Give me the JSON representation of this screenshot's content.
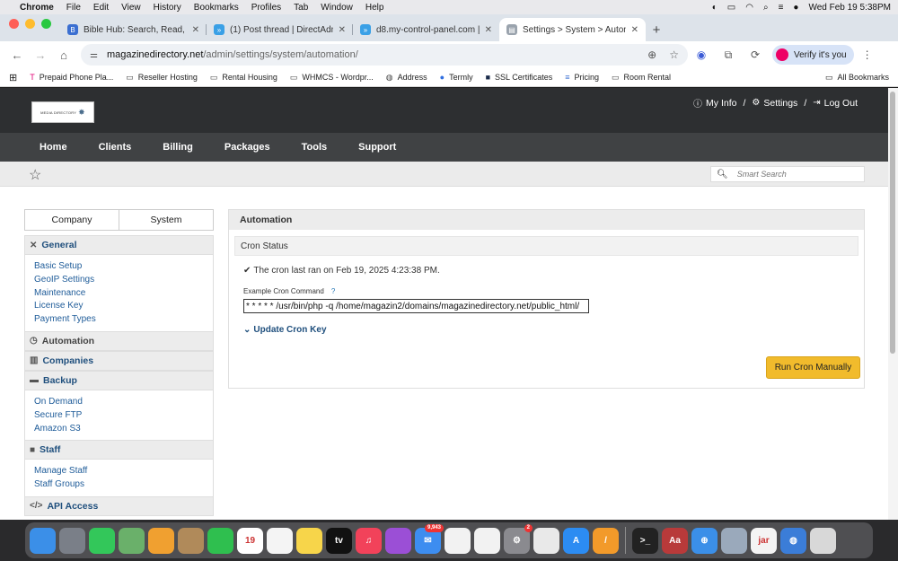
{
  "menubar": {
    "app": "Chrome",
    "items": [
      "File",
      "Edit",
      "View",
      "History",
      "Bookmarks",
      "Profiles",
      "Tab",
      "Window",
      "Help"
    ],
    "datetime": "Wed Feb 19  5:38PM"
  },
  "tabs": [
    {
      "title": "Bible Hub: Search, Read, Stu",
      "color": "#3b6fd1",
      "glyph": "B"
    },
    {
      "title": "(1) Post thread | DirectAdmin",
      "color": "#3aa0e6",
      "glyph": "»"
    },
    {
      "title": "d8.my-control-panel.com | C",
      "color": "#3aa0e6",
      "glyph": "»"
    },
    {
      "title": "Settings > System > Automati",
      "color": "#9aa3ad",
      "glyph": "▤"
    }
  ],
  "address": {
    "host": "magazinedirectory.net",
    "path": "/admin/settings/system/automation/",
    "verify_label": "Verify it's you"
  },
  "bookmarks": [
    {
      "label": "Prepaid Phone Pla...",
      "icon": "tmobile-icon",
      "glyph": "T",
      "color": "#e20074"
    },
    {
      "label": "Reseller Hosting",
      "icon": "folder-icon",
      "glyph": "▭",
      "color": "#444"
    },
    {
      "label": "Rental Housing",
      "icon": "folder-icon",
      "glyph": "▭",
      "color": "#444"
    },
    {
      "label": "WHMCS - Wordpr...",
      "icon": "folder-icon",
      "glyph": "▭",
      "color": "#444"
    },
    {
      "label": "Address",
      "icon": "globe-icon",
      "glyph": "◍",
      "color": "#444"
    },
    {
      "label": "Termly",
      "icon": "termly-icon",
      "glyph": "●",
      "color": "#2f6ee0"
    },
    {
      "label": "SSL Certificates",
      "icon": "ssl-icon",
      "glyph": "■",
      "color": "#1a2b4a"
    },
    {
      "label": "Pricing",
      "icon": "pricing-icon",
      "glyph": "≡",
      "color": "#3b6fd1"
    },
    {
      "label": "Room Rental",
      "icon": "folder-icon",
      "glyph": "▭",
      "color": "#444"
    }
  ],
  "all_bookmarks": "All Bookmarks",
  "site": {
    "logo_text": "MEDIA DIRECTORY",
    "toplinks": {
      "my_info": "My Info",
      "settings": "Settings",
      "logout": "Log Out",
      "sep": "/"
    },
    "nav": [
      "Home",
      "Clients",
      "Billing",
      "Packages",
      "Tools",
      "Support"
    ],
    "search_placeholder": "Smart Search"
  },
  "sidebar": {
    "tabs": [
      "Company",
      "System"
    ],
    "sections": [
      {
        "title": "General",
        "icon": "tools-icon",
        "glyph": "✕",
        "links": [
          "Basic Setup",
          "GeoIP Settings",
          "Maintenance",
          "License Key",
          "Payment Types"
        ]
      },
      {
        "title": "Automation",
        "icon": "clock-icon",
        "glyph": "◷",
        "links": []
      },
      {
        "title": "Companies",
        "icon": "building-icon",
        "glyph": "▥",
        "links": []
      },
      {
        "title": "Backup",
        "icon": "drive-icon",
        "glyph": "▬",
        "links": [
          "On Demand",
          "Secure FTP",
          "Amazon S3"
        ]
      },
      {
        "title": "Staff",
        "icon": "user-icon",
        "glyph": "■",
        "links": [
          "Manage Staff",
          "Staff Groups"
        ]
      },
      {
        "title": "API Access",
        "icon": "code-icon",
        "glyph": "</>",
        "links": []
      }
    ]
  },
  "panel": {
    "title": "Automation",
    "cron_status": "Cron Status",
    "last_ran": "The cron last ran on Feb 19, 2025 4:23:38 PM.",
    "cmd_label": "Example Cron Command",
    "cmd_help": "?",
    "cmd_value": "* * * * * /usr/bin/php -q /home/magazin2/domains/magazinedirectory.net/public_html/",
    "update_key": "Update Cron Key",
    "run_button": "Run Cron Manually"
  },
  "dock": {
    "apps": [
      {
        "name": "finder-icon",
        "color": "#3b8fe8",
        "label": ""
      },
      {
        "name": "launchpad-icon",
        "color": "#7a7f88",
        "label": ""
      },
      {
        "name": "messages-icon",
        "color": "#33c75a",
        "label": ""
      },
      {
        "name": "maps-icon",
        "color": "#6ab06a",
        "label": ""
      },
      {
        "name": "photos-icon",
        "color": "#f0a030",
        "label": ""
      },
      {
        "name": "contacts-icon",
        "color": "#b08a5a",
        "label": ""
      },
      {
        "name": "facetime-icon",
        "color": "#2fbf4f",
        "label": ""
      },
      {
        "name": "calendar-icon",
        "color": "#ffffff",
        "label": "19"
      },
      {
        "name": "reminders-icon",
        "color": "#f4f4f4",
        "label": ""
      },
      {
        "name": "notes-icon",
        "color": "#f7d54a",
        "label": ""
      },
      {
        "name": "tv-icon",
        "color": "#111111",
        "label": "tv"
      },
      {
        "name": "music-icon",
        "color": "#f2425a",
        "label": "♫"
      },
      {
        "name": "podcasts-icon",
        "color": "#9b4fd6",
        "label": ""
      },
      {
        "name": "mail-icon",
        "color": "#3d8df0",
        "label": "✉",
        "badge": "9,943"
      },
      {
        "name": "freeform-icon",
        "color": "#f2f2f2",
        "label": ""
      },
      {
        "name": "news-icon",
        "color": "#f2f2f2",
        "label": ""
      },
      {
        "name": "settings-icon",
        "color": "#8a8a8f",
        "label": "⚙",
        "badge": "2"
      },
      {
        "name": "chrome-icon",
        "color": "#e9e9e9",
        "label": ""
      },
      {
        "name": "appstore-icon",
        "color": "#2c8cf2",
        "label": "A"
      },
      {
        "name": "pages-icon",
        "color": "#f29a2a",
        "label": "/"
      }
    ],
    "apps2": [
      {
        "name": "terminal-icon",
        "color": "#222222",
        "label": ">_"
      },
      {
        "name": "dictionary-icon",
        "color": "#b83a3a",
        "label": "Aa"
      },
      {
        "name": "safari-icon",
        "color": "#3b8fe8",
        "label": "⊕"
      },
      {
        "name": "preview-icon",
        "color": "#9aa9bb",
        "label": ""
      },
      {
        "name": "java-icon",
        "color": "#f4f4f4",
        "label": "jar"
      },
      {
        "name": "network-icon",
        "color": "#3b7dd8",
        "label": "◍"
      },
      {
        "name": "trash-icon",
        "color": "#d8d8d8",
        "label": ""
      }
    ]
  }
}
